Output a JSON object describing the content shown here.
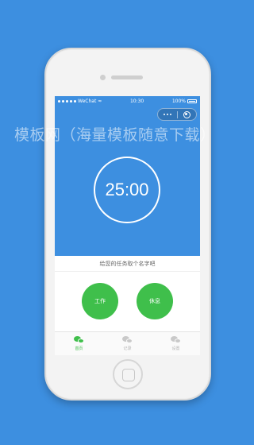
{
  "status_bar": {
    "carrier": "WeChat",
    "time": "10:30",
    "battery": "100%"
  },
  "timer": {
    "display": "25:00"
  },
  "task": {
    "prompt": "给您的任务取个名字吧"
  },
  "buttons": {
    "work": "工作",
    "rest": "休息"
  },
  "tabs": [
    {
      "label": "首页",
      "active": true
    },
    {
      "label": "记录",
      "active": false
    },
    {
      "label": "设置",
      "active": false
    }
  ],
  "watermark": "模板网（海量模板随意下载）",
  "colors": {
    "background": "#3d8fe0",
    "accent_green": "#3fbf4b"
  }
}
